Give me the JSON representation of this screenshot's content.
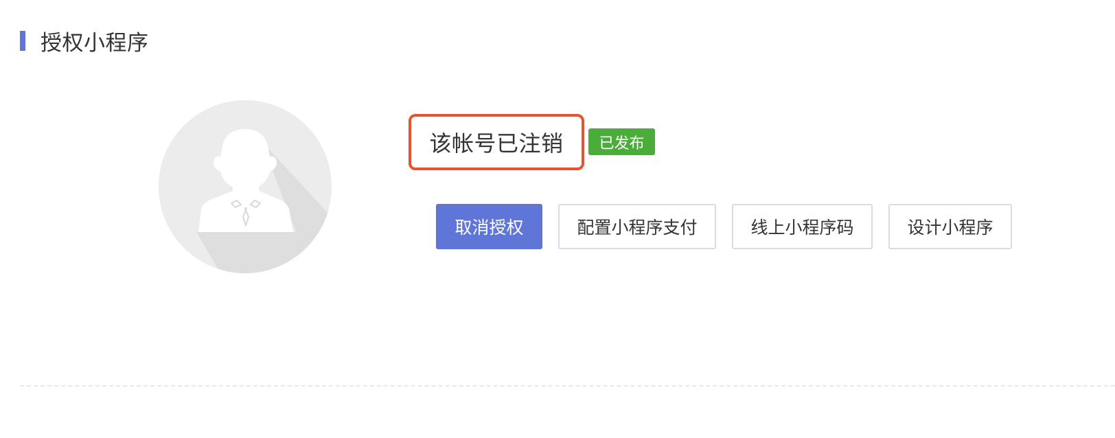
{
  "section": {
    "title": "授权小程序",
    "accent_color": "#6075d8"
  },
  "account": {
    "avatar_icon": "default-user-avatar-icon",
    "name": "该帐号已注销",
    "status": "已发布",
    "status_color": "#4aad3a",
    "highlight_color": "#e8522f"
  },
  "actions": {
    "cancel_auth": "取消授权",
    "config_payment": "配置小程序支付",
    "online_qrcode": "线上小程序码",
    "design": "设计小程序"
  }
}
